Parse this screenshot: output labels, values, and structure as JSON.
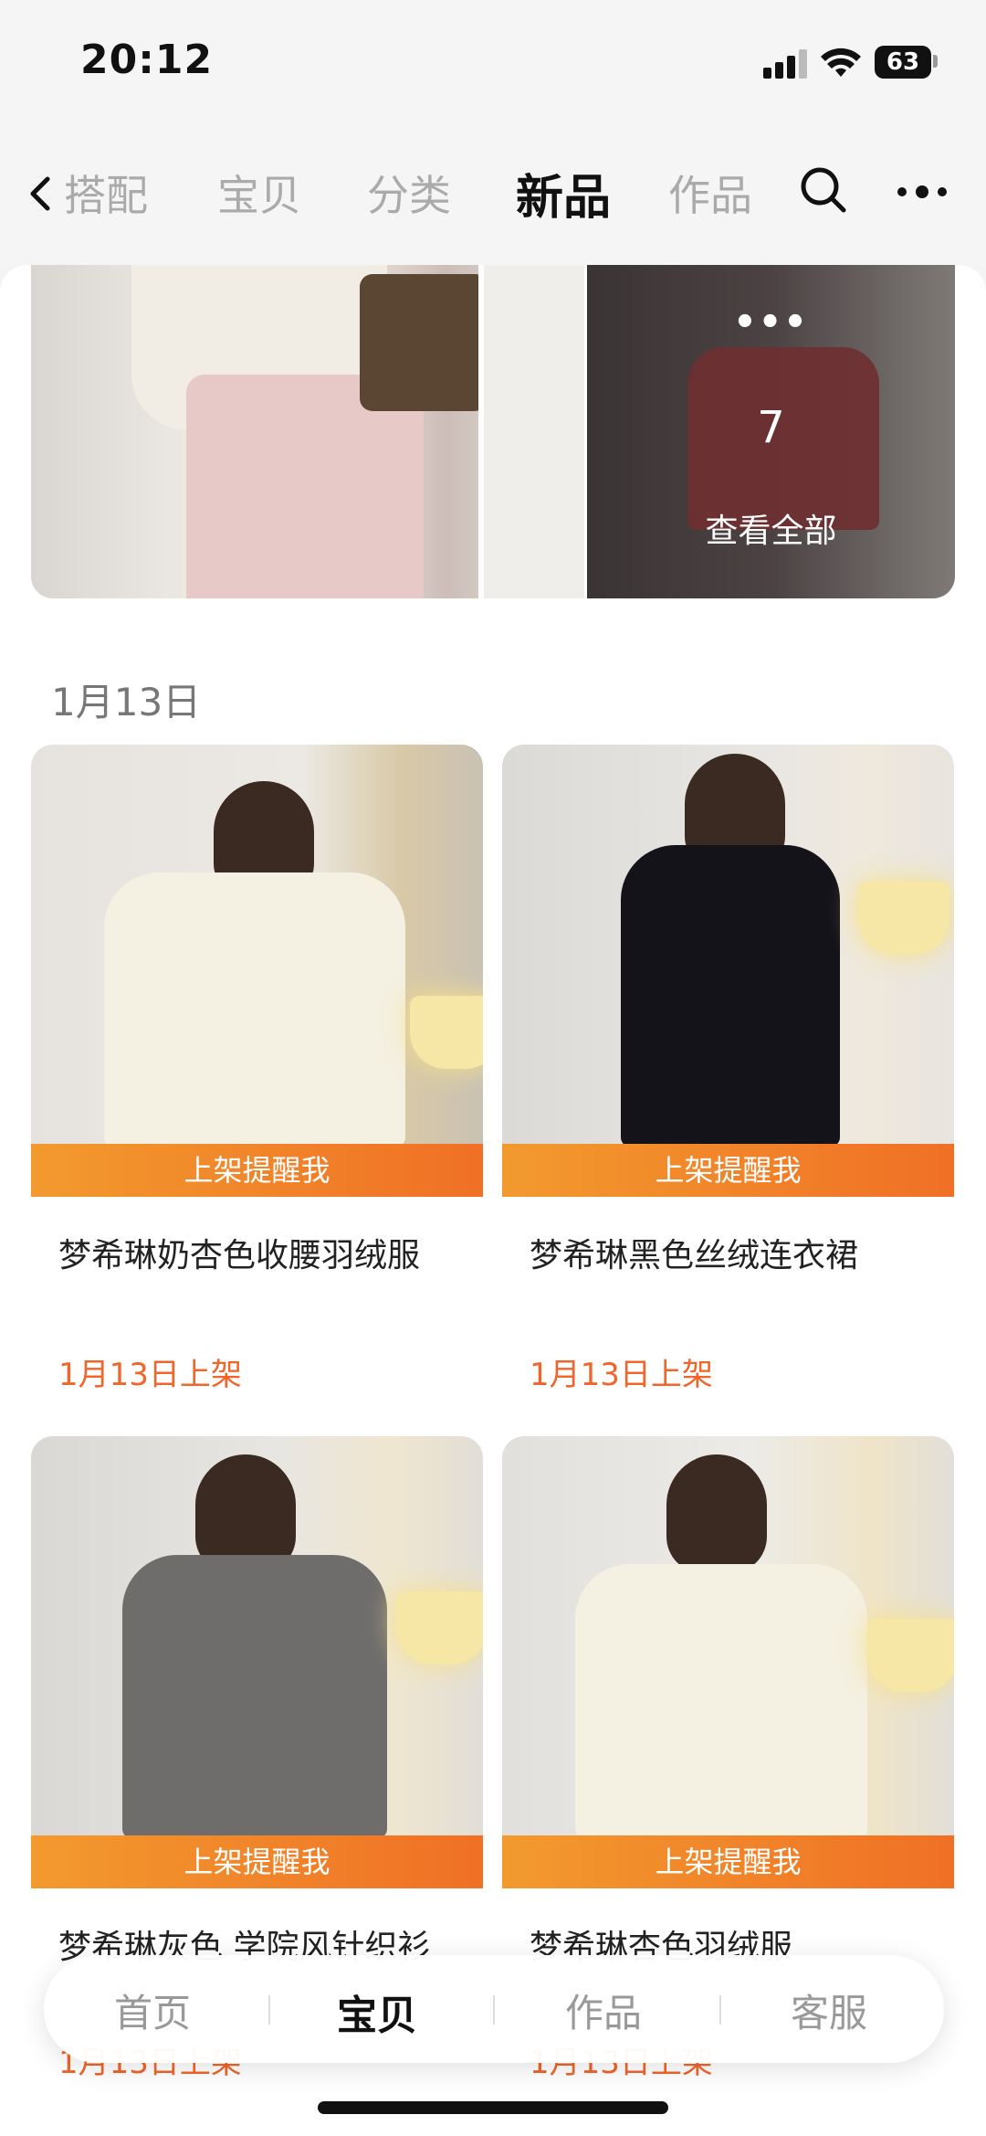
{
  "status": {
    "time": "20:12",
    "battery": "63"
  },
  "nav": {
    "tabs": [
      {
        "label": "搭配"
      },
      {
        "label": "宝贝"
      },
      {
        "label": "分类"
      },
      {
        "label": "新品"
      },
      {
        "label": "作品"
      }
    ],
    "active_tab": "新品"
  },
  "overlay": {
    "dots": "•••",
    "count": "7",
    "label": "查看全部"
  },
  "section_date": "1月13日",
  "products": [
    {
      "banner": "上架提醒我",
      "title": "梦希琳奶杏色收腰羽绒服",
      "date": "1月13日上架"
    },
    {
      "banner": "上架提醒我",
      "title": "梦希琳黑色丝绒连衣裙",
      "date": "1月13日上架"
    },
    {
      "banner": "上架提醒我",
      "title": "梦希琳灰色 学院风针织衫",
      "date": "1月13日上架"
    },
    {
      "banner": "上架提醒我",
      "title": "梦希琳杏色羽绒服",
      "date": "1月13日上架"
    }
  ],
  "bottom_tabs": [
    {
      "label": "首页"
    },
    {
      "label": "宝贝"
    },
    {
      "label": "作品"
    },
    {
      "label": "客服"
    }
  ],
  "bottom_active": "宝贝",
  "colors": {
    "accent_orange": "#f0652a",
    "banner_start": "#f29a2e",
    "banner_end": "#f07025"
  },
  "icons": [
    "back-icon",
    "search-icon",
    "more-icon",
    "signal-icon",
    "wifi-icon",
    "battery-icon"
  ]
}
